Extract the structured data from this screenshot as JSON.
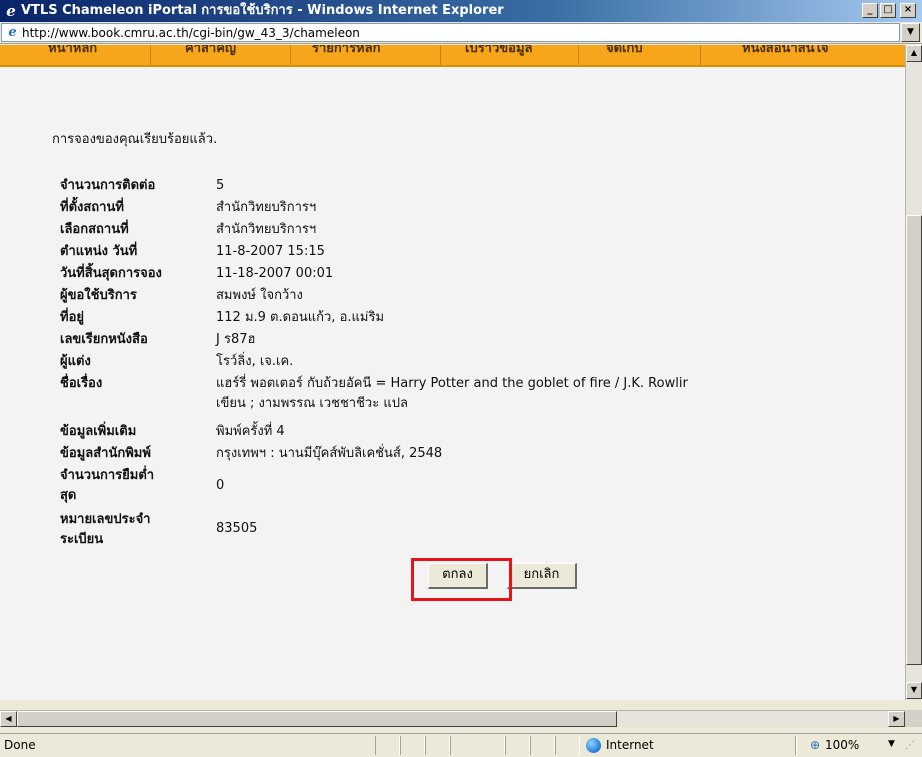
{
  "window": {
    "title": "VTLS Chameleon iPortal การขอใช้บริการ - Windows Internet Explorer",
    "controls": {
      "minimize": "_",
      "maximize": "□",
      "close": "×"
    }
  },
  "address_bar": {
    "url": "http://www.book.cmru.ac.th/cgi-bin/gw_43_3/chameleon"
  },
  "nav_tabs": [
    {
      "label": "หน้าหลัก"
    },
    {
      "label": "คำสำคัญ"
    },
    {
      "label": "รายการหลัก"
    },
    {
      "label": "เบราว์ข้อมูล"
    },
    {
      "label": "จัดเก็บ"
    },
    {
      "label": "หนังสือน่าสนใจ"
    }
  ],
  "confirmation_message": "การจองของคุณเรียบร้อยแล้ว.",
  "details": [
    {
      "label": "จำนวนการติดต่อ",
      "value": "5"
    },
    {
      "label": "ที่ตั้งสถานที่",
      "value": "สำนักวิทยบริการฯ"
    },
    {
      "label": "เลือกสถานที่",
      "value": "สำนักวิทยบริการฯ"
    },
    {
      "label": "ตำแหน่ง วันที่",
      "value": "11-8-2007 15:15"
    },
    {
      "label": "วันที่สิ้นสุดการจอง",
      "value": "11-18-2007 00:01"
    },
    {
      "label": "ผู้ขอใช้บริการ",
      "value": "สมพงษ์ ใจกว้าง"
    },
    {
      "label": "ที่อยู่",
      "value": "112 ม.9 ต.ดอนแก้ว, อ.แม่ริม"
    },
    {
      "label": "เลขเรียกหนังสือ",
      "value": "J ร87ฮ"
    },
    {
      "label": "ผู้แต่ง",
      "value": "โรว์ลิ่ง, เจ.เค."
    },
    {
      "label": "ชื่อเรื่อง",
      "value": "แฮร์รี่ พอตเตอร์ กับถ้วยอัคนี = Harry Potter and the goblet of fire / J.K. Rowlir",
      "value_line2": "เขียน ; งามพรรณ เวชชาชีวะ แปล"
    },
    {
      "label": "ข้อมูลเพิ่มเติม",
      "value": "พิมพ์ครั้งที่ 4"
    },
    {
      "label": "ข้อมูลสำนักพิมพ์",
      "value": "กรุงเทพฯ : นานมีบุ๊คส์พับลิเคชั่นส์, 2548"
    },
    {
      "label": "จำนวนการยืมต่ำ",
      "label_line2": "สุด",
      "value": "0"
    },
    {
      "label": "หมายเลขประจำ",
      "label_line2": "ระเบียน",
      "value": "83505"
    }
  ],
  "buttons": {
    "ok": "ตกลง",
    "cancel": "ยกเลิก"
  },
  "status_bar": {
    "status": "Done",
    "zone": "Internet",
    "zoom": "100%"
  },
  "colors": {
    "nav_background": "#f7a51b",
    "highlight_border": "#e8141c"
  }
}
